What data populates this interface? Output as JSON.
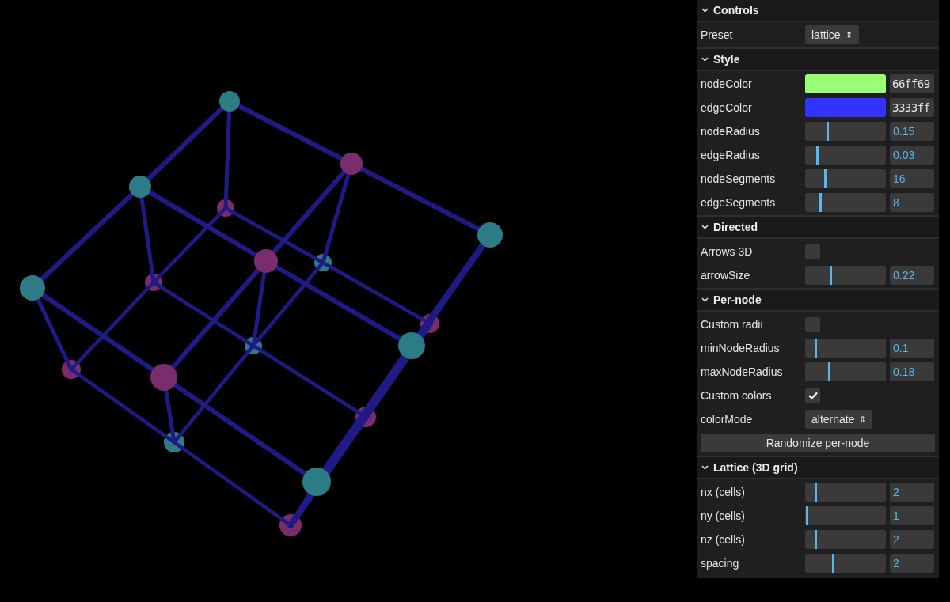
{
  "panel": {
    "sections": [
      {
        "title": "Controls",
        "expanded": true,
        "rows": [
          {
            "kind": "select",
            "label": "Preset",
            "value": "lattice",
            "icon": "⇕"
          }
        ]
      },
      {
        "title": "Style",
        "expanded": true,
        "rows": [
          {
            "kind": "color",
            "label": "nodeColor",
            "color": "#99ff77",
            "value": "66ff69"
          },
          {
            "kind": "color",
            "label": "edgeColor",
            "color": "#3333ff",
            "value": "3333ff"
          },
          {
            "kind": "slider",
            "label": "nodeRadius",
            "level": 0.27,
            "value": "0.15"
          },
          {
            "kind": "slider",
            "label": "edgeRadius",
            "level": 0.14,
            "value": "0.03"
          },
          {
            "kind": "slider",
            "label": "nodeSegments",
            "level": 0.24,
            "value": "16"
          },
          {
            "kind": "slider",
            "label": "edgeSegments",
            "level": 0.18,
            "value": "8"
          }
        ]
      },
      {
        "title": "Directed",
        "expanded": true,
        "rows": [
          {
            "kind": "checkbox",
            "label": "Arrows 3D",
            "checked": false
          },
          {
            "kind": "slider",
            "label": "arrowSize",
            "level": 0.31,
            "value": "0.22"
          }
        ]
      },
      {
        "title": "Per-node",
        "expanded": true,
        "rows": [
          {
            "kind": "checkbox",
            "label": "Custom radii",
            "checked": false
          },
          {
            "kind": "slider",
            "label": "minNodeRadius",
            "level": 0.12,
            "value": "0.1"
          },
          {
            "kind": "slider",
            "label": "maxNodeRadius",
            "level": 0.29,
            "value": "0.18"
          },
          {
            "kind": "checkbox",
            "label": "Custom colors",
            "checked": true
          },
          {
            "kind": "select",
            "label": "colorMode",
            "value": "alternate",
            "icon": "⇕"
          },
          {
            "kind": "button",
            "label": "Randomize per-node"
          }
        ]
      },
      {
        "title": "Lattice (3D grid)",
        "expanded": true,
        "rows": [
          {
            "kind": "slider",
            "label": "nx (cells)",
            "level": 0.12,
            "value": "2"
          },
          {
            "kind": "slider",
            "label": "ny (cells)",
            "level": 0.01,
            "value": "1"
          },
          {
            "kind": "slider",
            "label": "nz (cells)",
            "level": 0.12,
            "value": "2"
          },
          {
            "kind": "slider",
            "label": "spacing",
            "level": 0.34,
            "value": "2"
          }
        ]
      }
    ]
  }
}
